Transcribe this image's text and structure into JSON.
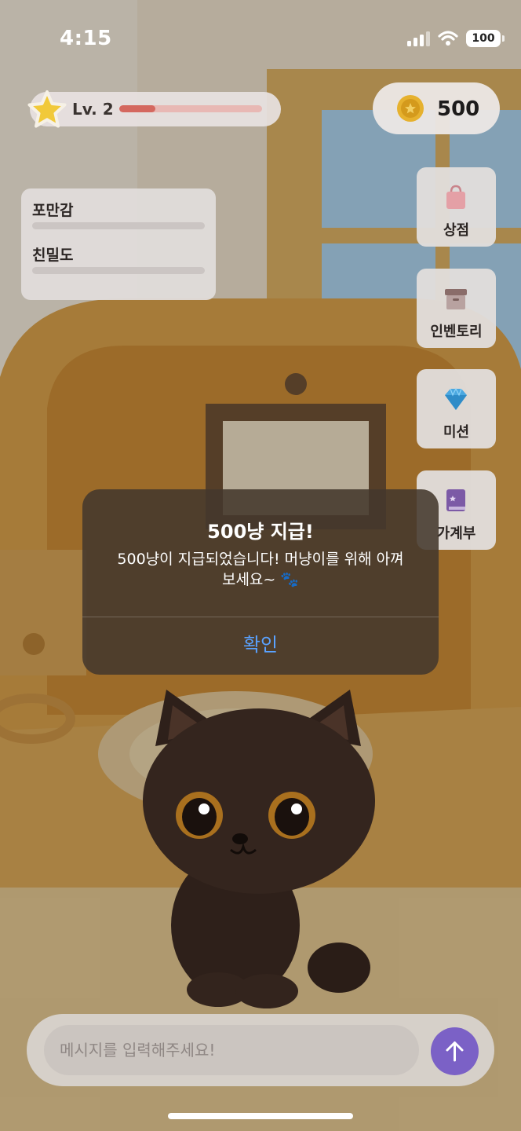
{
  "status_bar": {
    "time": "4:15",
    "battery": "100"
  },
  "hud": {
    "level_label": "Lv. 2",
    "xp_progress": 0.25,
    "coins": "500"
  },
  "stats": {
    "items": [
      {
        "label": "포만감",
        "value": 0
      },
      {
        "label": "친밀도",
        "value": 0
      }
    ]
  },
  "menu": {
    "items": [
      {
        "label": "상점",
        "icon": "shopping-bag-icon"
      },
      {
        "label": "인벤토리",
        "icon": "storage-box-icon"
      },
      {
        "label": "미션",
        "icon": "diamond-icon"
      },
      {
        "label": "가계부",
        "icon": "book-icon"
      }
    ]
  },
  "dialog": {
    "title": "500냥 지급!",
    "message": "500냥이 지급되었습니다! 머냥이를 위해 아껴보세요~ 🐾",
    "confirm_label": "확인"
  },
  "chat": {
    "placeholder": "메시지를 입력해주세요!"
  },
  "colors": {
    "accent": "#7b61c6",
    "confirm": "#5aa2ff",
    "xp": "#d4685f",
    "coin": "#e6b12e"
  }
}
